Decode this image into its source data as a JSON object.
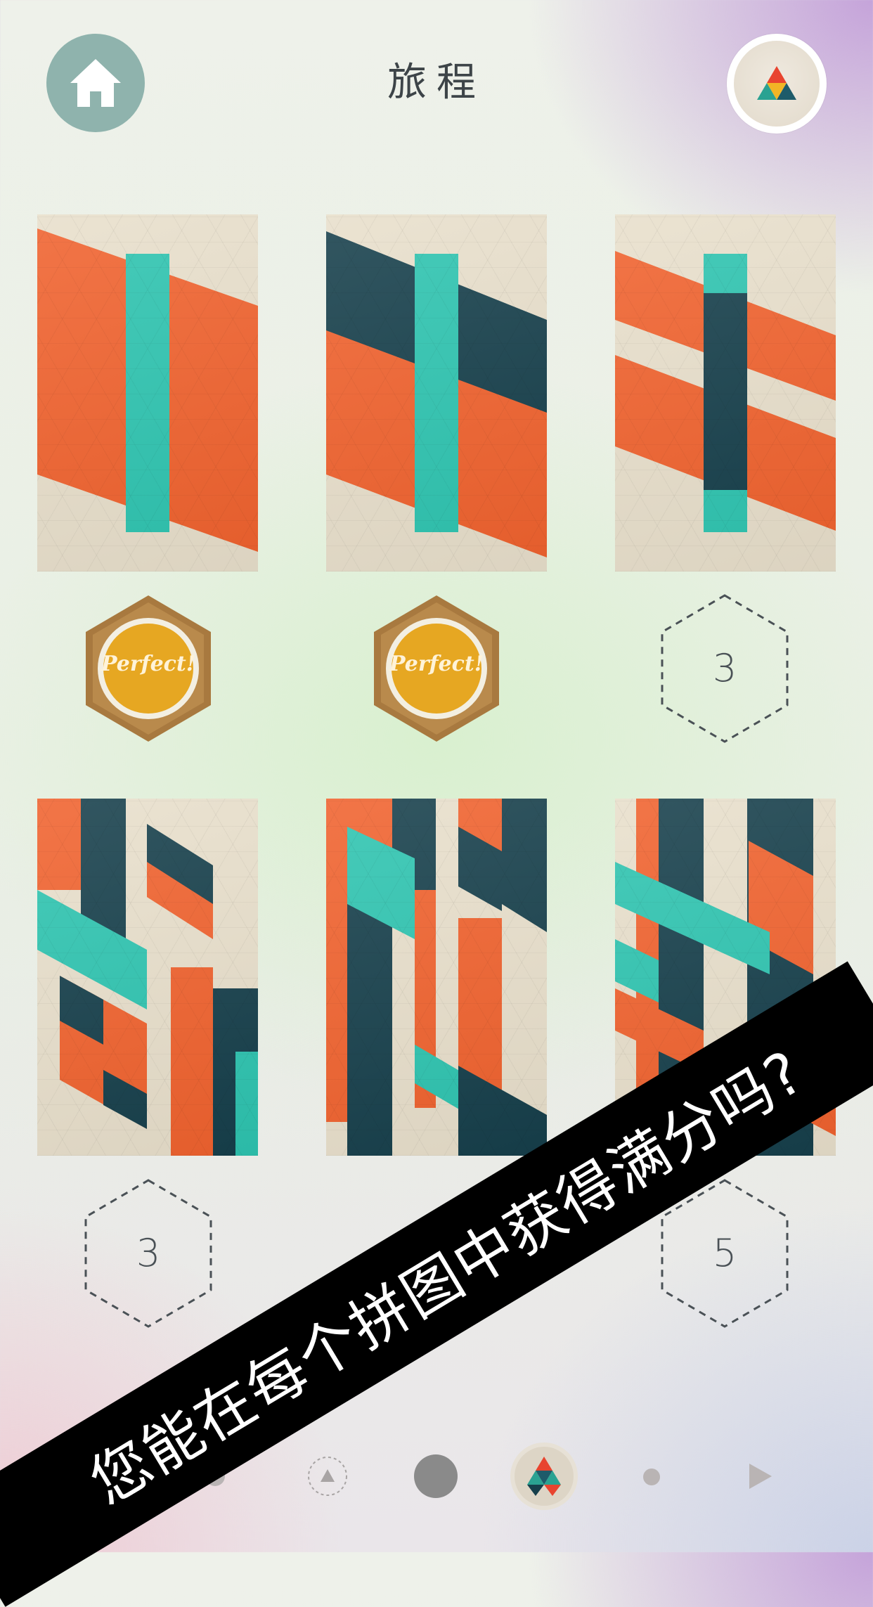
{
  "header": {
    "title": "旅程",
    "home_icon": "home-icon",
    "palette_icon": "palette-triangle-icon"
  },
  "puzzles": [
    {
      "id": 1,
      "status": "perfect",
      "badge_text": "Perfect!"
    },
    {
      "id": 2,
      "status": "perfect",
      "badge_text": "Perfect!"
    },
    {
      "id": 3,
      "status": "moves",
      "badge_text": "3"
    },
    {
      "id": 4,
      "status": "moves",
      "badge_text": "3"
    },
    {
      "id": 5,
      "status": "hidden",
      "badge_text": ""
    },
    {
      "id": 6,
      "status": "moves",
      "badge_text": "5"
    }
  ],
  "bottom_nav": {
    "items": [
      "circle-small-icon",
      "triangle-outline-icon",
      "circle-filled-icon",
      "palette-current-icon",
      "dot-icon",
      "play-arrow-icon"
    ],
    "current_index": 3
  },
  "promo_banner": {
    "text": "您能在每个拼图中获得满分吗?"
  },
  "colors": {
    "orange": "#f0622e",
    "teal": "#2ec4b0",
    "navy": "#163f4b",
    "paper": "#e8dfcb",
    "home_button": "#8fb3ad",
    "gold": "#e6a722"
  }
}
